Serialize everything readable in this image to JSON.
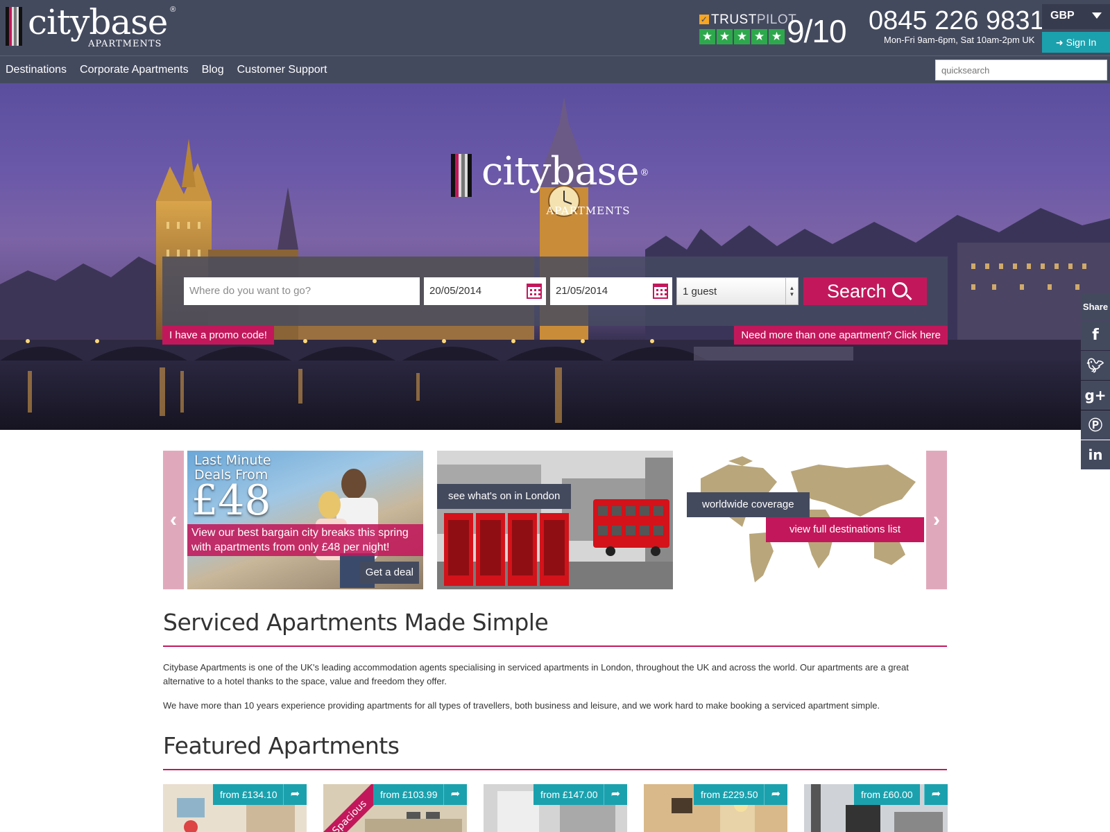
{
  "brand": {
    "name": "citybase",
    "sub": "APARTMENTS",
    "reg": "®",
    "colors": {
      "header": "#444a5e",
      "accent": "#c2185b",
      "teal": "#1ba1ae"
    }
  },
  "header": {
    "trustpilot": {
      "label_trust": "TRUST",
      "label_pilot": "PILOT",
      "score": "9/10",
      "stars": 5
    },
    "phone": "0845 226 9831",
    "hours": "Mon-Fri 9am-6pm, Sat 10am-2pm UK",
    "currency": "GBP",
    "signin_label": "Sign In"
  },
  "nav": {
    "items": [
      "Destinations",
      "Corporate Apartments",
      "Blog",
      "Customer Support"
    ],
    "quicksearch_placeholder": "quicksearch"
  },
  "hero": {
    "search": {
      "destination_placeholder": "Where do you want to go?",
      "checkin": "20/05/2014",
      "checkout": "21/05/2014",
      "guests": "1 guest",
      "button_label": "Search"
    },
    "promo_link": "I have a promo code!",
    "multi_link": "Need more than one apartment? Click here"
  },
  "share": {
    "label": "Share",
    "buttons": [
      "facebook-icon",
      "twitter-icon",
      "google-plus-icon",
      "pinterest-icon",
      "linkedin-icon"
    ]
  },
  "promos": {
    "deal": {
      "head1": "Last Minute",
      "head2": "Deals From",
      "price": "£48",
      "desc": "View our best bargain city breaks this spring with apartments from only £48 per night!",
      "cta": "Get a deal"
    },
    "london": {
      "tag": "see what's on in London"
    },
    "world": {
      "tag1": "worldwide coverage",
      "tag2": "view full destinations list"
    }
  },
  "intro": {
    "title": "Serviced Apartments Made Simple",
    "p1": "Citybase Apartments is one of the UK's leading accommodation agents specialising in serviced apartments in London, throughout the UK and across the world. Our apartments are a great alternative to a hotel thanks to the space, value and freedom they offer.",
    "p2": "We have more than 10 years experience providing apartments for all types of travellers, both business and leisure, and we work hard to make booking a serviced apartment simple."
  },
  "featured": {
    "title": "Featured Apartments",
    "items": [
      {
        "price": "from £134.10"
      },
      {
        "price": "from £103.99",
        "ribbon": "Spacious"
      },
      {
        "price": "from £147.00"
      },
      {
        "price": "from £229.50"
      },
      {
        "price": "from £60.00"
      }
    ]
  }
}
